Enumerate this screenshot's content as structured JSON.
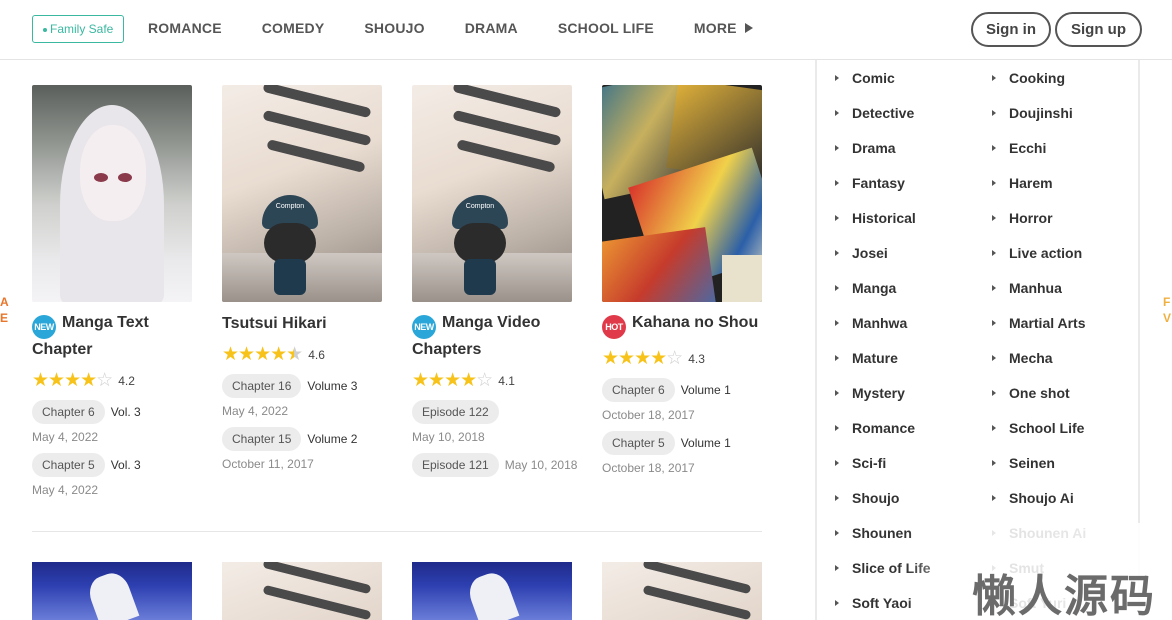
{
  "header": {
    "family_safe": "Family Safe",
    "nav": [
      "ROMANCE",
      "COMEDY",
      "SHOUJO",
      "DRAMA",
      "SCHOOL LIFE",
      "MORE"
    ],
    "sign_in": "Sign in",
    "sign_up": "Sign up"
  },
  "side": {
    "left": "A E",
    "right": "F V"
  },
  "cards": [
    {
      "badge": "NEW",
      "title": "Manga Text Chapter",
      "rating": 4.2,
      "rating_text": "4.2",
      "chapters": [
        {
          "chip": "Chapter 6",
          "vol": "Vol. 3",
          "date": "May 4, 2022"
        },
        {
          "chip": "Chapter 5",
          "vol": "Vol. 3",
          "date": "May 4, 2022"
        }
      ]
    },
    {
      "badge": "",
      "title": "Tsutsui Hikari",
      "rating": 4.6,
      "rating_text": "4.6",
      "chapters": [
        {
          "chip": "Chapter 16",
          "vol": "Volume 3",
          "date": "May 4, 2022"
        },
        {
          "chip": "Chapter 15",
          "vol": "Volume 2",
          "date": "October 11, 2017"
        }
      ]
    },
    {
      "badge": "NEW",
      "title": "Manga Video Chapters",
      "rating": 4.1,
      "rating_text": "4.1",
      "chapters": [
        {
          "chip": "Episode 122",
          "vol": "",
          "date": "May 10, 2018"
        },
        {
          "chip": "Episode 121",
          "vol": "",
          "date": "May 10, 2018"
        }
      ]
    },
    {
      "badge": "HOT",
      "title": "Kahana no Shou",
      "rating": 4.3,
      "rating_text": "4.3",
      "chapters": [
        {
          "chip": "Chapter 6",
          "vol": "Volume 1",
          "date": "October 18, 2017"
        },
        {
          "chip": "Chapter 5",
          "vol": "Volume 1",
          "date": "October 18, 2017"
        }
      ]
    }
  ],
  "thumb_label": "Compton",
  "genres_left": [
    "Comic",
    "Detective",
    "Drama",
    "Fantasy",
    "Historical",
    "Josei",
    "Manga",
    "Manhwa",
    "Mature",
    "Mystery",
    "Romance",
    "Sci-fi",
    "Shoujo",
    "Shounen",
    "Slice of Life",
    "Soft Yaoi"
  ],
  "genres_right": [
    "Cooking",
    "Doujinshi",
    "Ecchi",
    "Harem",
    "Horror",
    "Live action",
    "Manhua",
    "Martial Arts",
    "Mecha",
    "One shot",
    "School Life",
    "Seinen",
    "Shoujo Ai",
    "Shounen Ai",
    "Smut",
    "Soft Yuri"
  ],
  "watermark": "懒人源码",
  "colors": {
    "accent": "#3bb8a0",
    "star": "#f7c31a",
    "new_badge": "#2aa7d8",
    "hot_badge": "#e03a4a"
  },
  "icons": {
    "more": "triangle-right-icon",
    "genre_bullet": "caret-right-icon",
    "star": "star-icon"
  }
}
